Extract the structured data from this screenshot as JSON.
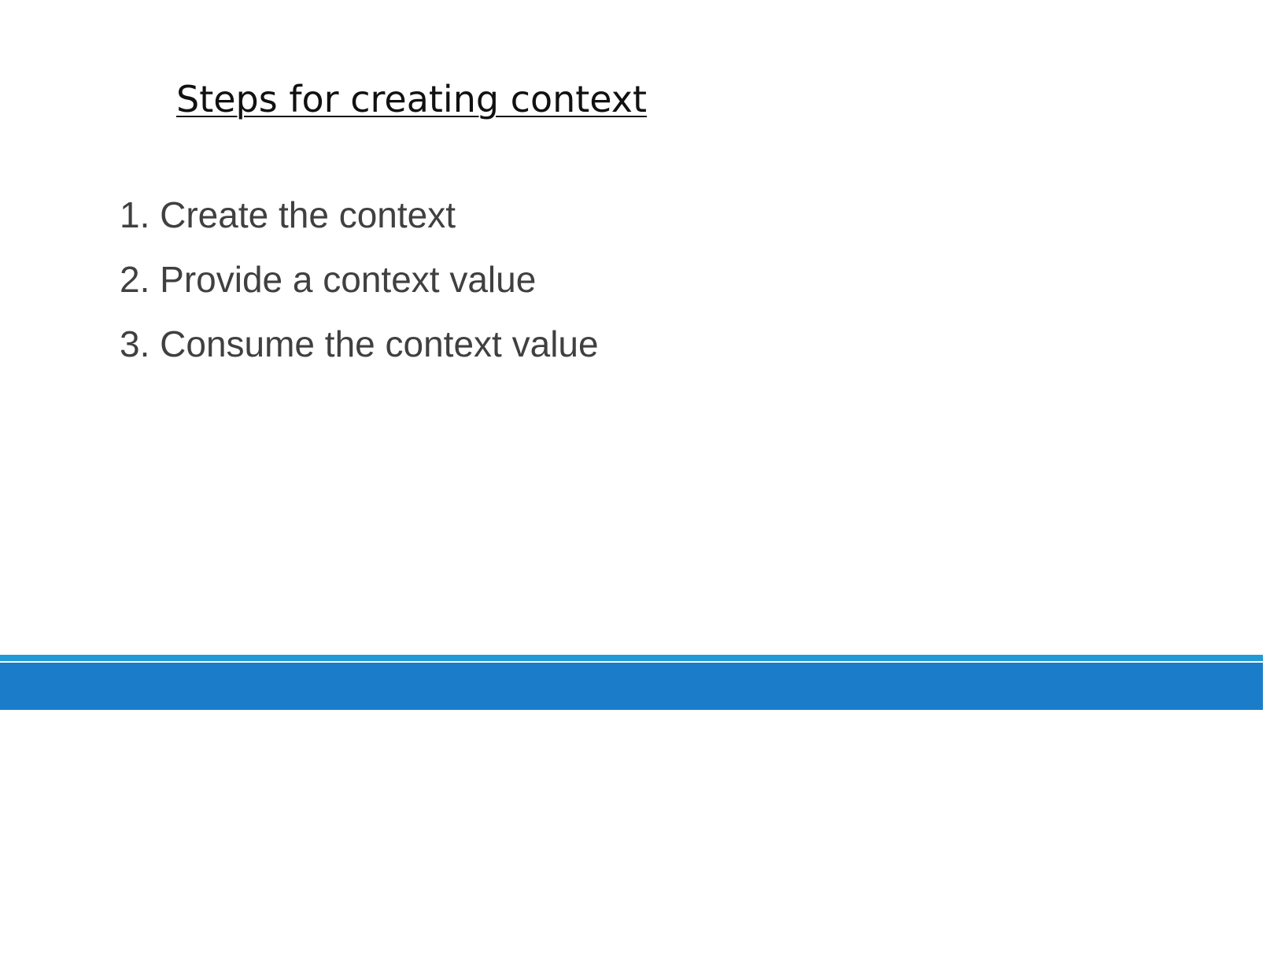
{
  "slide": {
    "title": "Steps for creating context",
    "steps": [
      "1. Create the context",
      "2. Provide a context value",
      "3. Consume the context value"
    ]
  },
  "colors": {
    "title_text": "#111111",
    "step_text": "#404040",
    "band_light_blue": "#1f9ad6",
    "band_dark_blue": "#1b7dc9",
    "background": "#ffffff"
  }
}
